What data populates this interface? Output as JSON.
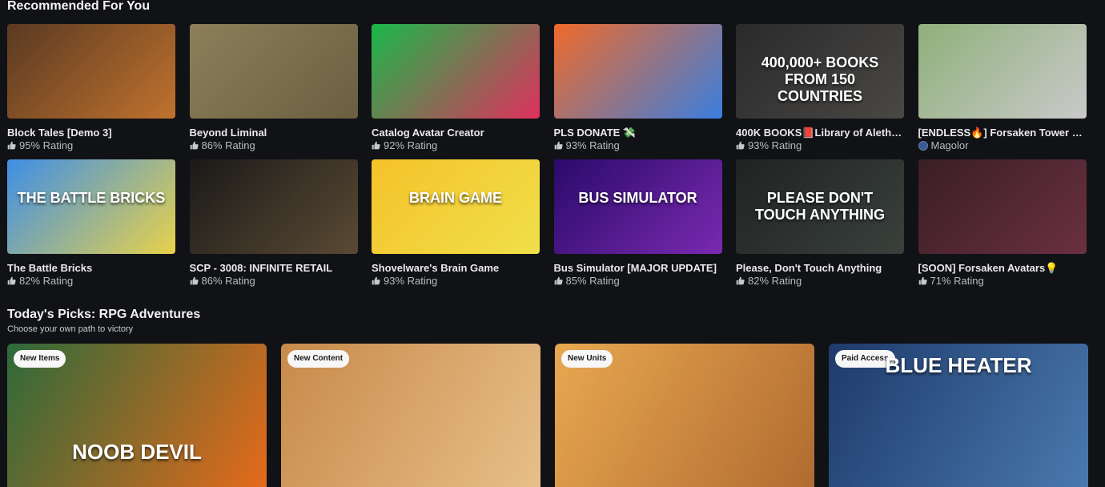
{
  "section": {
    "title": "Recommended For You"
  },
  "games": [
    {
      "title": "Block Tales [Demo 3]",
      "meta": "95% Rating",
      "meta_type": "rating",
      "colors": [
        "#5a3a22",
        "#c0722e"
      ],
      "thumb_text": ""
    },
    {
      "title": "Beyond Liminal",
      "meta": "86% Rating",
      "meta_type": "rating",
      "colors": [
        "#8c7f5a",
        "#6a5f40"
      ],
      "thumb_text": ""
    },
    {
      "title": "Catalog Avatar Creator",
      "meta": "92% Rating",
      "meta_type": "rating",
      "colors": [
        "#19b84a",
        "#e0305d"
      ],
      "thumb_text": ""
    },
    {
      "title": "PLS DONATE 💸",
      "meta": "93% Rating",
      "meta_type": "rating",
      "colors": [
        "#f06a2a",
        "#3a7ee0"
      ],
      "thumb_text": ""
    },
    {
      "title": "400K BOOKS📕Library of Aletheia",
      "meta": "93% Rating",
      "meta_type": "rating",
      "colors": [
        "#2a2a2c",
        "#4a4844"
      ],
      "thumb_text": "400,000+ BOOKS FROM 150 COUNTRIES"
    },
    {
      "title": "[ENDLESS🔥] Forsaken Tower Def...",
      "meta": "Magolor",
      "meta_type": "creator",
      "colors": [
        "#8fb07a",
        "#c9c9c9"
      ],
      "thumb_text": ""
    },
    {
      "title": "The Battle Bricks",
      "meta": "82% Rating",
      "meta_type": "rating",
      "colors": [
        "#3d8ee8",
        "#e8d24a"
      ],
      "thumb_text": "THE BATTLE BRICKS"
    },
    {
      "title": "SCP - 3008: INFINITE RETAIL",
      "meta": "86% Rating",
      "meta_type": "rating",
      "colors": [
        "#1b1a18",
        "#5a4a34"
      ],
      "thumb_text": ""
    },
    {
      "title": "Shovelware's Brain Game",
      "meta": "93% Rating",
      "meta_type": "rating",
      "colors": [
        "#f5c22a",
        "#f0e04a"
      ],
      "thumb_text": "BRAIN GAME"
    },
    {
      "title": "Bus Simulator [MAJOR UPDATE]",
      "meta": "85% Rating",
      "meta_type": "rating",
      "colors": [
        "#2a0a6a",
        "#7a2ab0"
      ],
      "thumb_text": "BUS SIMULATOR"
    },
    {
      "title": "Please, Don't Touch Anything",
      "meta": "82% Rating",
      "meta_type": "rating",
      "colors": [
        "#1f2422",
        "#3a403c"
      ],
      "thumb_text": "PLEASE DON'T TOUCH ANYTHING"
    },
    {
      "title": "[SOON] Forsaken Avatars💡",
      "meta": "71% Rating",
      "meta_type": "rating",
      "colors": [
        "#3a1e26",
        "#6a3040"
      ],
      "thumb_text": ""
    }
  ],
  "picks": {
    "title": "Today's Picks: RPG Adventures",
    "subtitle": "Choose your own path to victory",
    "items": [
      {
        "badge": "New Items",
        "colors": [
          "#2d6a3a",
          "#e86a1a"
        ],
        "thumb_text": "NOOB  DEVIL"
      },
      {
        "badge": "New Content",
        "colors": [
          "#c88a4a",
          "#e8c08a"
        ],
        "thumb_text": ""
      },
      {
        "badge": "New Units",
        "colors": [
          "#e8a850",
          "#b06a30"
        ],
        "thumb_text": ""
      },
      {
        "badge": "Paid Access",
        "colors": [
          "#1e3a6a",
          "#4a7ab0"
        ],
        "thumb_text": "BLUE HEATER"
      }
    ]
  }
}
